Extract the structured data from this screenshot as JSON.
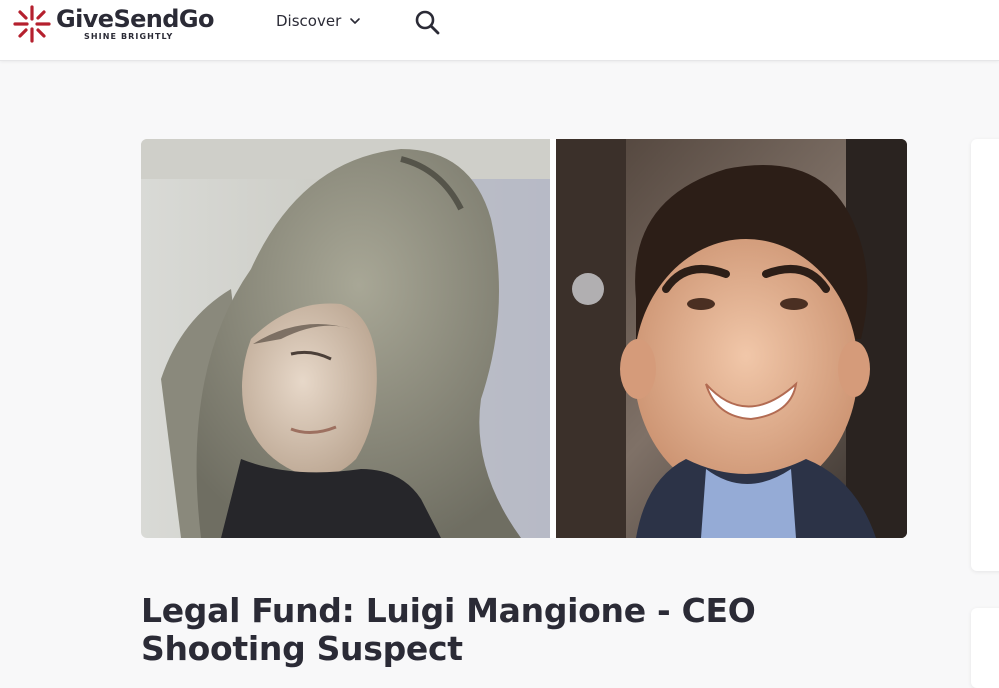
{
  "header": {
    "brand_name": "GiveSendGo",
    "brand_tagline": "SHINE BRIGHTLY",
    "nav_discover_label": "Discover",
    "icons": {
      "logo": "sunburst-logo-icon",
      "discover_chevron": "chevron-down-icon",
      "search": "search-icon"
    }
  },
  "campaign": {
    "title": "Legal Fund: Luigi Mangione - CEO Shooting Suspect",
    "images": [
      "hooded-surveillance-photo",
      "smiling-portrait-photo"
    ]
  },
  "colors": {
    "brand_accent": "#b5202e",
    "text_primary": "#2b2b36",
    "page_background": "#f8f8f9",
    "header_background": "#ffffff"
  }
}
